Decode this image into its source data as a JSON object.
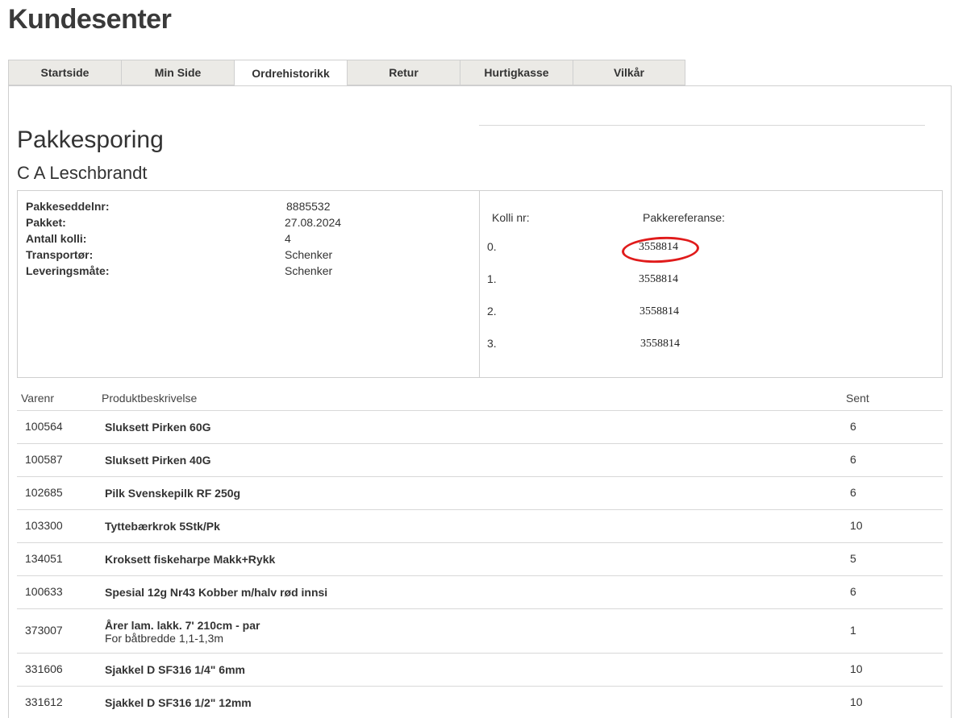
{
  "header": {
    "title": "Kundesenter"
  },
  "tabs": [
    {
      "label": "Startside",
      "active": false
    },
    {
      "label": "Min Side",
      "active": false
    },
    {
      "label": "Ordrehistorikk",
      "active": true
    },
    {
      "label": "Retur",
      "active": false
    },
    {
      "label": "Hurtigkasse",
      "active": false
    },
    {
      "label": "Vilkår",
      "active": false
    }
  ],
  "tracking": {
    "title": "Pakkesporing",
    "customer": "C A Leschbrandt",
    "info": [
      {
        "label": "Pakkeseddelnr:",
        "value": "8885532"
      },
      {
        "label": "Pakket:",
        "value": "27.08.2024"
      },
      {
        "label": "Antall kolli:",
        "value": "4"
      },
      {
        "label": "Transportør:",
        "value": "Schenker"
      },
      {
        "label": "Leveringsmåte:",
        "value": "Schenker"
      }
    ],
    "kolli_header": {
      "nr": "Kolli nr:",
      "ref": "Pakkereferanse:"
    },
    "kolli": [
      {
        "nr": "0.",
        "ref": "3558814",
        "highlighted": true
      },
      {
        "nr": "1.",
        "ref": "3558814",
        "highlighted": false
      },
      {
        "nr": "2.",
        "ref": "3558814",
        "highlighted": false
      },
      {
        "nr": "3.",
        "ref": "3558814",
        "highlighted": false
      }
    ],
    "highlight_color": "#e01b1b"
  },
  "products": {
    "headers": {
      "varenr": "Varenr",
      "desc": "Produktbeskrivelse",
      "sent": "Sent"
    },
    "rows": [
      {
        "varenr": "100564",
        "desc": "Sluksett Pirken 60G",
        "sub": "",
        "sent": "6"
      },
      {
        "varenr": "100587",
        "desc": "Sluksett Pirken 40G",
        "sub": "",
        "sent": "6"
      },
      {
        "varenr": "102685",
        "desc": "Pilk Svenskepilk RF 250g",
        "sub": "",
        "sent": "6"
      },
      {
        "varenr": "103300",
        "desc": "Tyttebærkrok 5Stk/Pk",
        "sub": "",
        "sent": "10"
      },
      {
        "varenr": "134051",
        "desc": "Kroksett fiskeharpe Makk+Rykk",
        "sub": "",
        "sent": "5"
      },
      {
        "varenr": "100633",
        "desc": "Spesial 12g Nr43 Kobber m/halv rød innsi",
        "sub": "",
        "sent": "6"
      },
      {
        "varenr": "373007",
        "desc": "Årer lam. lakk. 7' 210cm - par",
        "sub": "For båtbredde 1,1-1,3m",
        "sent": "1"
      },
      {
        "varenr": "331606",
        "desc": "Sjakkel D SF316 1/4\" 6mm",
        "sub": "",
        "sent": "10"
      },
      {
        "varenr": "331612",
        "desc": "Sjakkel D SF316 1/2\" 12mm",
        "sub": "",
        "sent": "10"
      }
    ]
  }
}
